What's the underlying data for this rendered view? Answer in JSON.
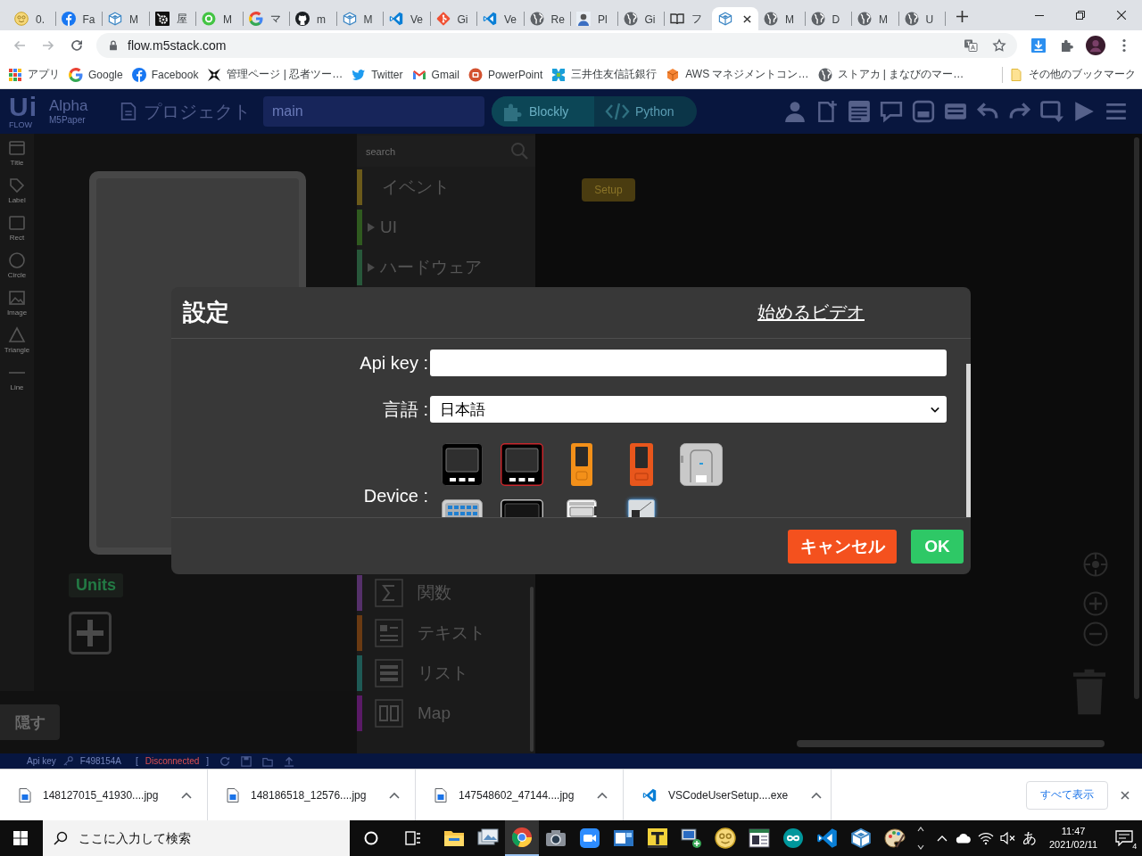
{
  "browser": {
    "tabs": [
      {
        "kind": "smiley",
        "title": "0.",
        "selected": false
      },
      {
        "kind": "facebook",
        "title": "Fa",
        "selected": false
      },
      {
        "kind": "cube",
        "title": "M",
        "selected": false
      },
      {
        "kind": "gear",
        "title": "屋",
        "selected": false
      },
      {
        "kind": "ring",
        "title": "M",
        "selected": false
      },
      {
        "kind": "google",
        "title": "マ",
        "selected": false
      },
      {
        "kind": "github",
        "title": "m",
        "selected": false
      },
      {
        "kind": "cube",
        "title": "M",
        "selected": false
      },
      {
        "kind": "vscode",
        "title": "Ve",
        "selected": false
      },
      {
        "kind": "git",
        "title": "Gi",
        "selected": false
      },
      {
        "kind": "vscode",
        "title": "Ve",
        "selected": false
      },
      {
        "kind": "globe",
        "title": "Re",
        "selected": false
      },
      {
        "kind": "person",
        "title": "Pl",
        "selected": false
      },
      {
        "kind": "globe",
        "title": "Gi",
        "selected": false
      },
      {
        "kind": "book",
        "title": "フ",
        "selected": false
      },
      {
        "kind": "cube",
        "selected": true
      },
      {
        "kind": "globe",
        "title": "M",
        "selected": false
      },
      {
        "kind": "globe",
        "title": "D",
        "selected": false
      },
      {
        "kind": "globe",
        "title": "M",
        "selected": false
      },
      {
        "kind": "globe",
        "title": "U",
        "selected": false
      }
    ],
    "address_bar": {
      "url": "flow.m5stack.com"
    },
    "bookmarks": [
      {
        "kind": "apps",
        "label": "アプリ"
      },
      {
        "kind": "google",
        "label": "Google"
      },
      {
        "kind": "facebook",
        "label": "Facebook"
      },
      {
        "kind": "ninja",
        "label": "管理ページ | 忍者ツー…"
      },
      {
        "kind": "twitter",
        "label": "Twitter"
      },
      {
        "kind": "gmail",
        "label": "Gmail"
      },
      {
        "kind": "powerpoint",
        "label": "PowerPoint"
      },
      {
        "kind": "bank",
        "label": "三井住友信託銀行"
      },
      {
        "kind": "aws",
        "label": "AWS マネジメントコン…"
      },
      {
        "kind": "globe",
        "label": "ストアカ | まなびのマー…"
      }
    ],
    "other_bookmarks": {
      "kind": "folder",
      "label": "その他のブックマーク"
    }
  },
  "app": {
    "header": {
      "logo": "Ui",
      "logo_caption": "FLOW",
      "edition": "Alpha",
      "device": "M5Paper",
      "project_button": "プロジェクト",
      "file_name": "main",
      "modes": [
        {
          "kind": "blockly",
          "label": "Blockly",
          "selected": true
        },
        {
          "kind": "python",
          "label": "Python",
          "selected": false
        }
      ]
    },
    "tools": [
      {
        "kind": "title",
        "label": "Title"
      },
      {
        "kind": "label",
        "label": "Label"
      },
      {
        "kind": "rect",
        "label": "Rect"
      },
      {
        "kind": "circle",
        "label": "Circle"
      },
      {
        "kind": "image",
        "label": "Image"
      },
      {
        "kind": "triangle",
        "label": "Triangle"
      },
      {
        "kind": "line",
        "label": "Line"
      }
    ],
    "units_label": "Units",
    "hide_button": "隠す",
    "palette": {
      "search_placeholder": "search",
      "groups": [
        {
          "categories": [
            {
              "label": "イベント",
              "color": "#6b5a1a"
            },
            {
              "label": "UI",
              "color": "#2f5a1f",
              "expanded": false
            },
            {
              "label": "ハードウェア",
              "color": "#27583a",
              "expanded": false
            }
          ]
        },
        {
          "categories": [
            {
              "kind": "sum",
              "label": "関数",
              "color": "#55306a"
            },
            {
              "kind": "text",
              "label": "テキスト",
              "color": "#6a3a12"
            },
            {
              "kind": "list",
              "label": "リスト",
              "color": "#1e5a55"
            },
            {
              "kind": "map",
              "label": "Map",
              "color": "#5a1a66"
            }
          ]
        }
      ]
    },
    "canvas": {
      "block": "Setup"
    },
    "status_bar": {
      "api_key_label": "Api key",
      "api_key": "F498154A",
      "bracket_open": "[",
      "connection": "Disconnected",
      "bracket_close": "]"
    }
  },
  "dialog": {
    "title": "設定",
    "video_link": "始めるビデオ",
    "fields": [
      {
        "kind": "input",
        "label": "Api key :"
      },
      {
        "kind": "select",
        "label": "言語 :",
        "value": "日本語"
      },
      {
        "kind": "devices",
        "label": "Device :",
        "devices": [
          {
            "kind": "core",
            "selected": false
          },
          {
            "kind": "fire",
            "selected": false
          },
          {
            "kind": "stick",
            "selected": false
          },
          {
            "kind": "stickplus",
            "selected": false
          },
          {
            "kind": "atom",
            "selected": false
          },
          {
            "kind": "matrix",
            "selected": false
          },
          {
            "kind": "core2",
            "selected": false
          },
          {
            "kind": "coreink",
            "selected": false
          },
          {
            "kind": "paper",
            "selected": true
          }
        ]
      }
    ],
    "buttons": [
      {
        "kind": "cancel",
        "label": "キャンセル"
      },
      {
        "kind": "ok",
        "label": "OK"
      }
    ]
  },
  "downloads": {
    "items": [
      {
        "kind": "image",
        "file": "148127015_41930....jpg"
      },
      {
        "kind": "image",
        "file": "148186518_12576....jpg"
      },
      {
        "kind": "image",
        "file": "147548602_47144....jpg"
      },
      {
        "kind": "vscode",
        "file": "VSCodeUserSetup....exe"
      }
    ],
    "show_all": "すべて表示"
  },
  "taskbar": {
    "search_placeholder": "ここに入力して検索",
    "apps": [
      {
        "kind": "explorer",
        "selected": false
      },
      {
        "kind": "gallery",
        "selected": false
      },
      {
        "kind": "chrome",
        "selected": true
      },
      {
        "kind": "camera",
        "selected": false
      },
      {
        "kind": "video",
        "selected": false
      },
      {
        "kind": "card",
        "selected": false
      },
      {
        "kind": "tile",
        "selected": false
      },
      {
        "kind": "network",
        "selected": false
      },
      {
        "kind": "smiley",
        "selected": false
      },
      {
        "kind": "window",
        "selected": false
      },
      {
        "kind": "infinity",
        "selected": false
      },
      {
        "kind": "vscode",
        "selected": false
      },
      {
        "kind": "cube",
        "selected": false
      },
      {
        "kind": "palette",
        "selected": false
      }
    ],
    "ime": "あ",
    "time": "11:47",
    "date": "2021/02/11",
    "notification_count": "4"
  }
}
